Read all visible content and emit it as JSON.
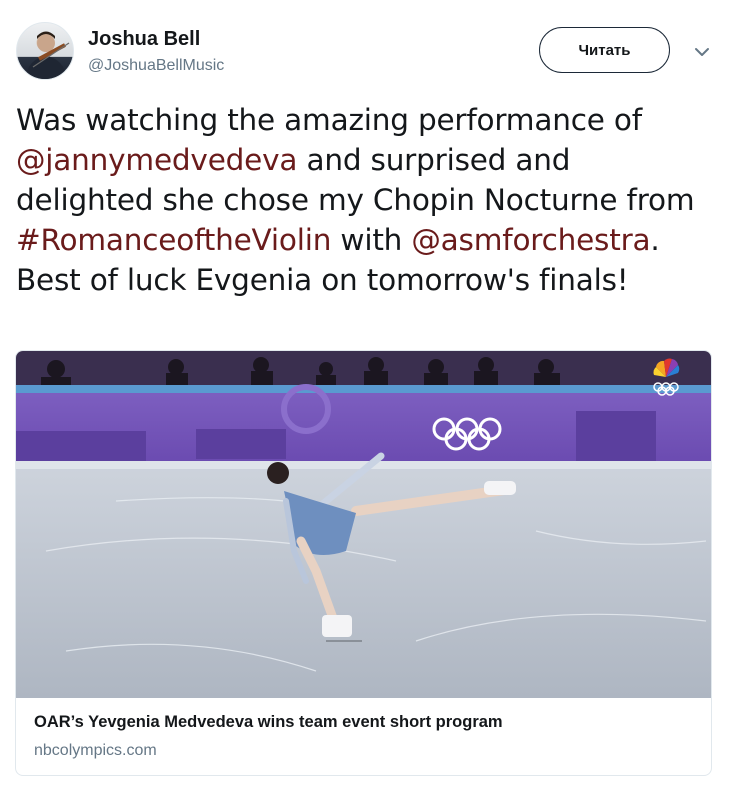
{
  "user": {
    "name": "Joshua Bell",
    "handle": "@JoshuaBellMusic"
  },
  "actions": {
    "follow_label": "Читать",
    "menu_icon": "chevron-down-icon"
  },
  "tweet": {
    "segments": [
      {
        "text": "Was watching the amazing performance of "
      },
      {
        "text": "@jannymedvedeva",
        "link": true
      },
      {
        "text": " and surprised and delighted she chose my Chopin Nocturne from "
      },
      {
        "text": "#RomanceoftheViolin",
        "link": true
      },
      {
        "text": " with "
      },
      {
        "text": "@asmforchestra",
        "link": true
      },
      {
        "text": ". Best of luck Evgenia on tomorrow's finals!"
      }
    ]
  },
  "card": {
    "title": "OAR’s Yevgenia Medvedeva wins team event short program",
    "domain": "nbcolympics.com",
    "image_alt": "figure skater on ice rink"
  },
  "colors": {
    "link": "#6a1b1b",
    "text": "#14171a",
    "secondary": "#657786",
    "border": "#e1e8ed"
  }
}
